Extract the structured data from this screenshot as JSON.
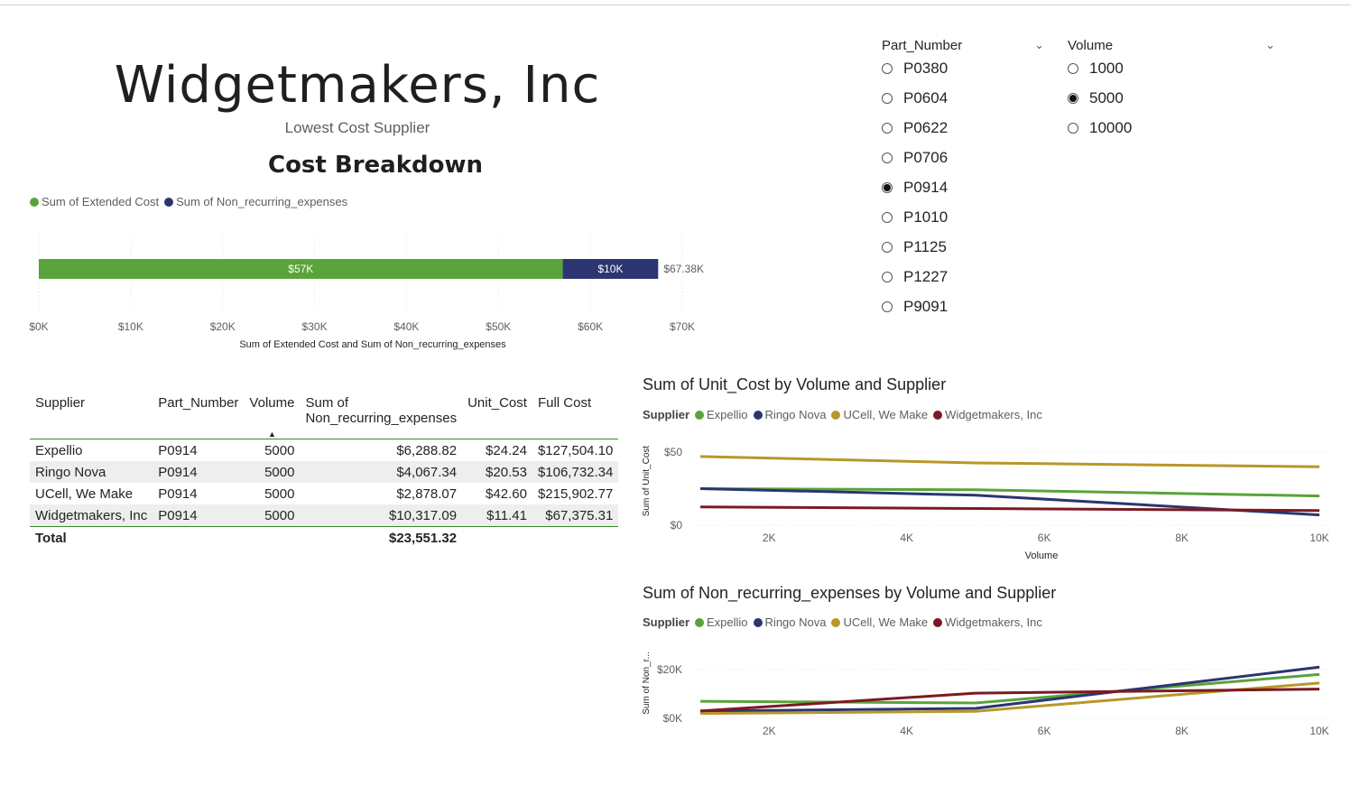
{
  "header": {
    "title": "Widgetmakers, Inc",
    "subtitle": "Lowest Cost Supplier"
  },
  "colors": {
    "green": "#5aa33a",
    "navy": "#2b3571",
    "gold": "#b8972a",
    "maroon": "#7b1a22"
  },
  "cost_breakdown": {
    "title": "Cost Breakdown",
    "legend": [
      "Sum of Extended Cost",
      "Sum of Non_recurring_expenses"
    ],
    "xlabel": "Sum of Extended Cost and Sum of Non_recurring_expenses"
  },
  "slicers": {
    "part_number": {
      "title": "Part_Number",
      "options": [
        "P0380",
        "P0604",
        "P0622",
        "P0706",
        "P0914",
        "P1010",
        "P1125",
        "P1227",
        "P9091"
      ],
      "selected": "P0914"
    },
    "volume": {
      "title": "Volume",
      "options": [
        "1000",
        "5000",
        "10000"
      ],
      "selected": "5000"
    }
  },
  "table": {
    "columns": [
      "Supplier",
      "Part_Number",
      "Volume",
      "Sum of Non_recurring_expenses",
      "Unit_Cost",
      "Full Cost"
    ],
    "sort_indicator": "▲",
    "rows": [
      [
        "Expellio",
        "P0914",
        "5000",
        "$6,288.82",
        "$24.24",
        "$127,504.10"
      ],
      [
        "Ringo Nova",
        "P0914",
        "5000",
        "$4,067.34",
        "$20.53",
        "$106,732.34"
      ],
      [
        "UCell, We Make",
        "P0914",
        "5000",
        "$2,878.07",
        "$42.60",
        "$215,902.77"
      ],
      [
        "Widgetmakers, Inc",
        "P0914",
        "5000",
        "$10,317.09",
        "$11.41",
        "$67,375.31"
      ]
    ],
    "total": {
      "label": "Total",
      "non_recurring": "$23,551.32"
    }
  },
  "line_legend": {
    "label": "Supplier",
    "items": [
      "Expellio",
      "Ringo Nova",
      "UCell, We Make",
      "Widgetmakers, Inc"
    ]
  },
  "chart_data": [
    {
      "type": "bar",
      "stacked": true,
      "orientation": "horizontal",
      "title": "Cost Breakdown",
      "xlabel": "Sum of Extended Cost and Sum of Non_recurring_expenses",
      "xlim": [
        0,
        70000
      ],
      "xticks": [
        "$0K",
        "$10K",
        "$20K",
        "$30K",
        "$40K",
        "$50K",
        "$60K",
        "$70K"
      ],
      "series": [
        {
          "name": "Sum of Extended Cost",
          "values": [
            57000
          ],
          "label": "$57K"
        },
        {
          "name": "Sum of Non_recurring_expenses",
          "values": [
            10380
          ],
          "label": "$10K"
        }
      ],
      "total_label": "$67.38K",
      "legend": "top-left"
    },
    {
      "type": "line",
      "title": "Sum of Unit_Cost by Volume and Supplier",
      "xlabel": "Volume",
      "ylabel": "Sum of Unit_Cost",
      "x": [
        1000,
        5000,
        10000
      ],
      "xlim": [
        1000,
        10000
      ],
      "xticks": [
        "2K",
        "4K",
        "6K",
        "8K",
        "10K"
      ],
      "ylim": [
        0,
        50
      ],
      "yticks": [
        "$0",
        "$50"
      ],
      "legend": "top-left",
      "series": [
        {
          "name": "Expellio",
          "values": [
            25,
            24.24,
            20
          ]
        },
        {
          "name": "Ringo Nova",
          "values": [
            25,
            20.53,
            7
          ]
        },
        {
          "name": "UCell, We Make",
          "values": [
            47,
            42.6,
            40
          ]
        },
        {
          "name": "Widgetmakers, Inc",
          "values": [
            12.5,
            11.41,
            10
          ]
        }
      ]
    },
    {
      "type": "line",
      "title": "Sum of Non_recurring_expenses by Volume and Supplier",
      "xlabel": "",
      "ylabel": "Sum of Non_r...",
      "x": [
        1000,
        5000,
        10000
      ],
      "xlim": [
        1000,
        10000
      ],
      "xticks": [
        "2K",
        "4K",
        "6K",
        "8K",
        "10K"
      ],
      "ylim": [
        0,
        20000
      ],
      "yticks": [
        "$0K",
        "$20K"
      ],
      "legend": "top-left",
      "series": [
        {
          "name": "Expellio",
          "values": [
            7000,
            6288.82,
            18000
          ]
        },
        {
          "name": "Ringo Nova",
          "values": [
            3000,
            4067.34,
            21000
          ]
        },
        {
          "name": "UCell, We Make",
          "values": [
            2000,
            2878.07,
            14500
          ]
        },
        {
          "name": "Widgetmakers, Inc",
          "values": [
            3000,
            10317.09,
            12000
          ]
        }
      ]
    }
  ]
}
